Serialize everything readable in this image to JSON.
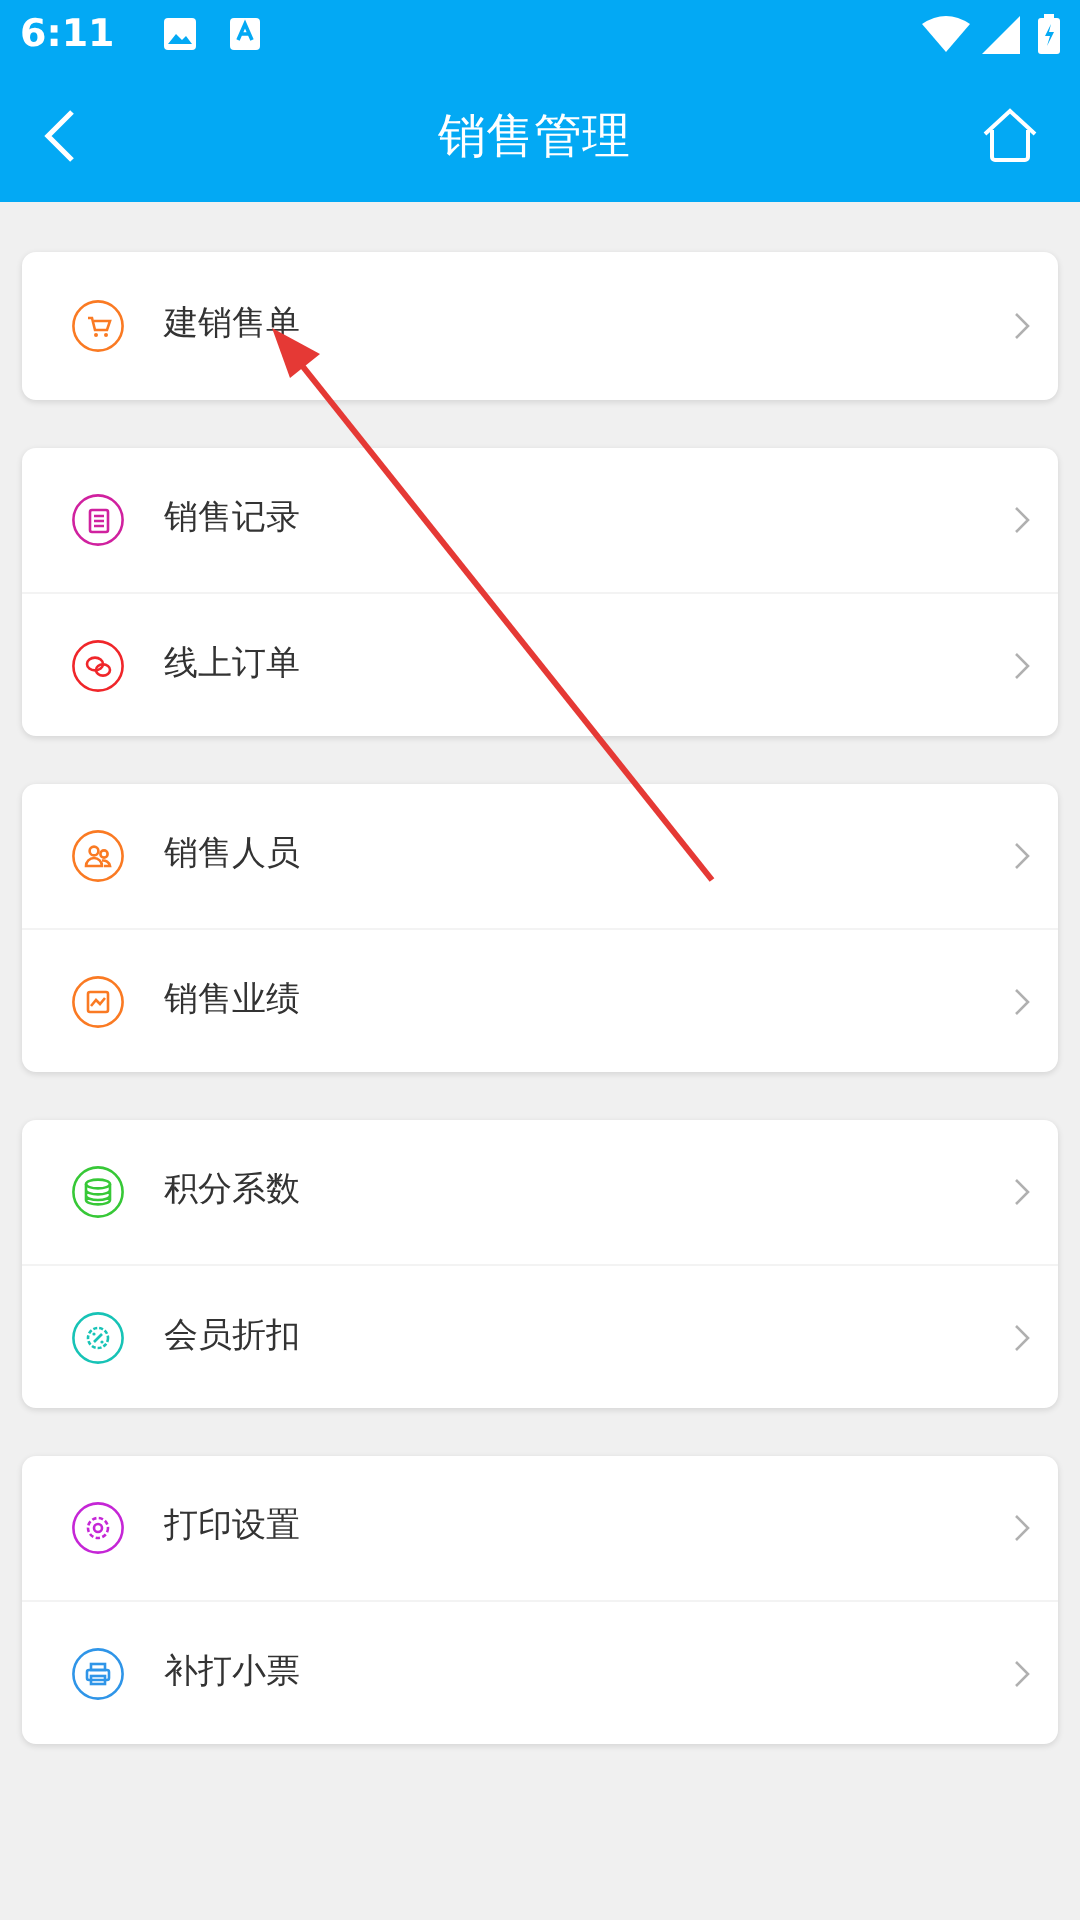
{
  "status_bar": {
    "time": "6:11"
  },
  "header": {
    "title": "销售管理"
  },
  "groups": [
    {
      "items": [
        {
          "label": "建销售单",
          "kind": "cart",
          "color": "#fa7a23"
        }
      ]
    },
    {
      "items": [
        {
          "label": "销售记录",
          "kind": "scroll",
          "color": "#d0219f"
        },
        {
          "label": "线上订单",
          "kind": "chat",
          "color": "#f0262a"
        }
      ]
    },
    {
      "items": [
        {
          "label": "销售人员",
          "kind": "people",
          "color": "#fa7a23"
        },
        {
          "label": "销售业绩",
          "kind": "chart",
          "color": "#fa7a23"
        }
      ]
    },
    {
      "items": [
        {
          "label": "积分系数",
          "kind": "coins",
          "color": "#37c837"
        },
        {
          "label": "会员折扣",
          "kind": "badge",
          "color": "#17c3b6"
        }
      ]
    },
    {
      "items": [
        {
          "label": "打印设置",
          "kind": "gear",
          "color": "#c526d6"
        },
        {
          "label": "补打小票",
          "kind": "printer",
          "color": "#2f95e8"
        }
      ]
    }
  ]
}
